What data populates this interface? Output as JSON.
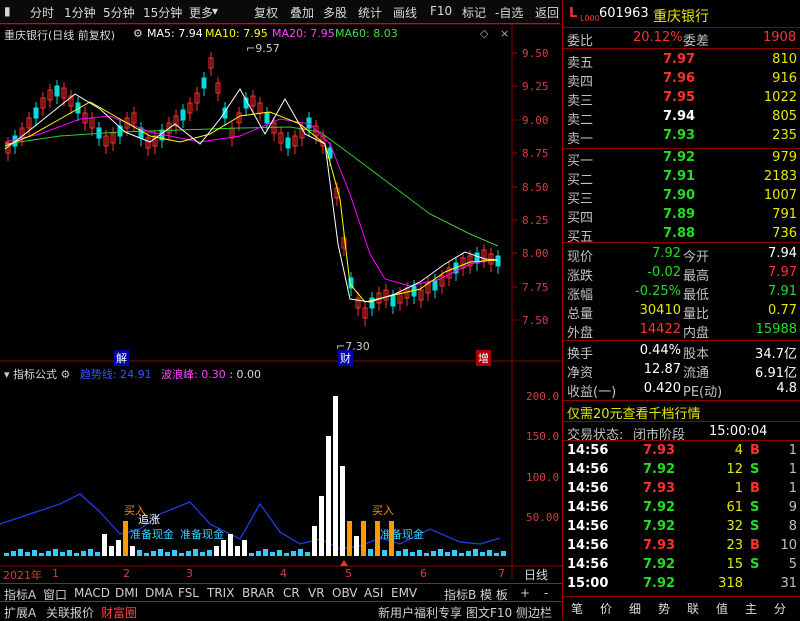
{
  "toolbar": {
    "left": [
      "分时",
      "1分钟",
      "5分钟",
      "15分钟",
      "更多"
    ],
    "right": [
      "复权",
      "叠加",
      "多股",
      "统计",
      "画线",
      "F10",
      "标记",
      "-自选",
      "返回"
    ]
  },
  "header": {
    "code": "601963",
    "name": "重庆银行",
    "prefix": "L",
    "sub": "L000"
  },
  "legend": {
    "title": "重庆银行(日线 前复权)",
    "ma5": "MA5: 7.94",
    "ma10": "MA10: 7.95",
    "ma20": "MA20: 7.95",
    "ma60": "MA60: 8.03"
  },
  "yaxis_main": [
    "9.50",
    "9.25",
    "9.00",
    "8.75",
    "8.50",
    "8.25",
    "8.00",
    "7.75",
    "7.50"
  ],
  "annotations": {
    "high": "9.57",
    "low": "7.30",
    "jie": "解",
    "cai": "财",
    "zeng": "增"
  },
  "indicator": {
    "title": "指标公式",
    "trend": "趋势线: 24.91",
    "wave": "波浪峰: 0.30",
    "extra": ": 0.00",
    "yaxis": [
      "200.0",
      "150.0",
      "100.0",
      "50.00"
    ],
    "labels": [
      "买入",
      "追涨",
      "准备现金",
      "准备现金",
      "买入",
      "准备现金"
    ]
  },
  "timeline": {
    "year": "2021年",
    "months": [
      "1",
      "2",
      "3",
      "4",
      "5",
      "6",
      "7"
    ],
    "period": "日线"
  },
  "bottom_tabs": [
    "指标A",
    "窗口",
    "MACD",
    "DMI",
    "DMA",
    "FSL",
    "TRIX",
    "BRAR",
    "CR",
    "VR",
    "OBV",
    "ASI",
    "EMV",
    "指标B",
    "模 板",
    "+",
    "-"
  ],
  "bottom_row2": [
    "扩展A",
    "关联报价",
    "财富圈",
    "新用户福利专享",
    "图文F10",
    "侧边栏"
  ],
  "quote": {
    "weibi": {
      "label": "委比",
      "value": "20.12%",
      "label2": "委差",
      "value2": "1908"
    },
    "sell": [
      {
        "label": "卖五",
        "price": "7.97",
        "vol": "810"
      },
      {
        "label": "卖四",
        "price": "7.96",
        "vol": "916"
      },
      {
        "label": "卖三",
        "price": "7.95",
        "vol": "1022"
      },
      {
        "label": "卖二",
        "price": "7.94",
        "vol": "805"
      },
      {
        "label": "卖一",
        "price": "7.93",
        "vol": "235"
      }
    ],
    "buy": [
      {
        "label": "买一",
        "price": "7.92",
        "vol": "979"
      },
      {
        "label": "买二",
        "price": "7.91",
        "vol": "2183"
      },
      {
        "label": "买三",
        "price": "7.90",
        "vol": "1007"
      },
      {
        "label": "买四",
        "price": "7.89",
        "vol": "791"
      },
      {
        "label": "买五",
        "price": "7.88",
        "vol": "736"
      }
    ],
    "stats": [
      {
        "l1": "现价",
        "v1": "7.92",
        "l2": "今开",
        "v2": "7.94"
      },
      {
        "l1": "涨跌",
        "v1": "-0.02",
        "l2": "最高",
        "v2": "7.97"
      },
      {
        "l1": "涨幅",
        "v1": "-0.25%",
        "l2": "最低",
        "v2": "7.91"
      },
      {
        "l1": "总量",
        "v1": "30410",
        "l2": "量比",
        "v2": "0.77"
      },
      {
        "l1": "外盘",
        "v1": "14422",
        "l2": "内盘",
        "v2": "15988"
      }
    ],
    "stats2": [
      {
        "l1": "换手",
        "v1": "0.44%",
        "l2": "股本",
        "v2": "34.7亿"
      },
      {
        "l1": "净资",
        "v1": "12.87",
        "l2": "流通",
        "v2": "6.91亿"
      },
      {
        "l1": "收益(一)",
        "v1": "0.420",
        "l2": "PE(动)",
        "v2": "4.8"
      }
    ],
    "promo": "仅需20元查看千档行情",
    "status_label": "交易状态:",
    "status": "闭市阶段",
    "status_time": "15:00:04",
    "ticks": [
      {
        "t": "14:56",
        "p": "7.93",
        "v": "4",
        "d": "B",
        "n": "1"
      },
      {
        "t": "14:56",
        "p": "7.92",
        "v": "12",
        "d": "S",
        "n": "1"
      },
      {
        "t": "14:56",
        "p": "7.93",
        "v": "1",
        "d": "B",
        "n": "1"
      },
      {
        "t": "14:56",
        "p": "7.92",
        "v": "61",
        "d": "S",
        "n": "9"
      },
      {
        "t": "14:56",
        "p": "7.92",
        "v": "32",
        "d": "S",
        "n": "8"
      },
      {
        "t": "14:56",
        "p": "7.93",
        "v": "23",
        "d": "B",
        "n": "10"
      },
      {
        "t": "14:56",
        "p": "7.92",
        "v": "15",
        "d": "S",
        "n": "5"
      },
      {
        "t": "15:00",
        "p": "7.92",
        "v": "318",
        "d": "",
        "n": "31"
      }
    ],
    "bottom_icons": [
      "笔",
      "价",
      "细",
      "势",
      "联",
      "值",
      "主",
      "分"
    ]
  },
  "colors": {
    "up": "#ff3030",
    "down": "#22dd22",
    "ma5": "#ffffff",
    "ma10": "#ffff00",
    "ma20": "#ff00ff",
    "ma60": "#33cc33"
  }
}
